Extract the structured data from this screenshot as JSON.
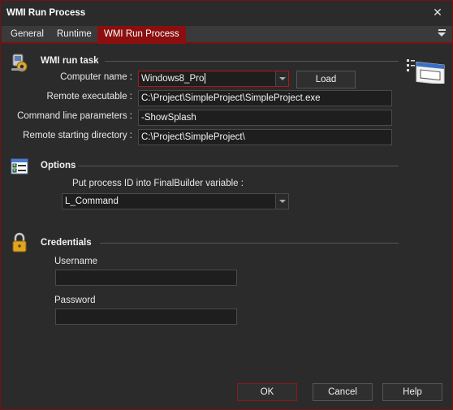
{
  "window": {
    "title": "WMI Run Process",
    "close_glyph": "✕"
  },
  "tabs": [
    {
      "label": "General"
    },
    {
      "label": "Runtime"
    },
    {
      "label": "WMI Run Process",
      "active": true
    }
  ],
  "wmi_run_task": {
    "title": "WMI run task",
    "computer_name_label": "Computer name :",
    "computer_name_value": "Windows8_Pro",
    "load_button": "Load",
    "remote_executable_label": "Remote executable :",
    "remote_executable_value": "C:\\Project\\SimpleProject\\SimpleProject.exe",
    "command_line_label": "Command line parameters :",
    "command_line_value": "-ShowSplash",
    "remote_dir_label": "Remote starting directory :",
    "remote_dir_value": "C:\\Project\\SimpleProject\\"
  },
  "options": {
    "title": "Options",
    "process_id_label": "Put process ID into FinalBuilder variable :",
    "process_id_value": "L_Command"
  },
  "credentials": {
    "title": "Credentials",
    "username_label": "Username",
    "username_value": "",
    "password_label": "Password",
    "password_value": ""
  },
  "footer": {
    "ok": "OK",
    "cancel": "Cancel",
    "help": "Help"
  },
  "colors": {
    "accent": "#8b0f0f",
    "background": "#2b2b2b",
    "field": "#1e1e1e"
  },
  "icons": {
    "wmi_task": "gear-computer-icon",
    "options": "checklist-icon",
    "credentials": "padlock-icon",
    "action_type": "window-run-icon"
  }
}
